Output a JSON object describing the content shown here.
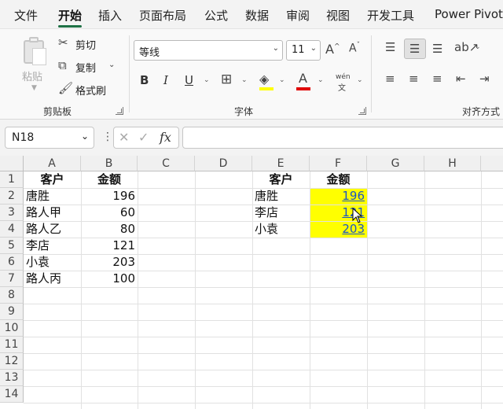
{
  "menu": {
    "tabs": [
      {
        "label": "文件"
      },
      {
        "label": "开始"
      },
      {
        "label": "插入"
      },
      {
        "label": "页面布局"
      },
      {
        "label": "公式"
      },
      {
        "label": "数据"
      },
      {
        "label": "审阅"
      },
      {
        "label": "视图"
      },
      {
        "label": "开发工具"
      },
      {
        "label": "Power Pivot"
      }
    ],
    "active": "开始"
  },
  "ribbon": {
    "clipboard": {
      "paste": "粘贴",
      "cut": "剪切",
      "copy": "复制",
      "format_painter": "格式刷",
      "group_label": "剪贴板"
    },
    "font": {
      "font_name": "等线",
      "font_size": "11",
      "bold": "B",
      "italic": "I",
      "underline": "U",
      "font_color_letter": "A",
      "phonetic": "wén",
      "group_label": "字体",
      "grow_icon": "A^",
      "shrink_icon": "Aˇ",
      "highlight_color": "#ffff00",
      "font_color": "#e00000"
    },
    "alignment": {
      "group_label": "对齐方式"
    }
  },
  "formula_bar": {
    "name_box": "N18",
    "fx": "fx",
    "formula": ""
  },
  "sheet": {
    "columns": [
      "A",
      "B",
      "C",
      "D",
      "E",
      "F",
      "G",
      "H"
    ],
    "rows": [
      "1",
      "2",
      "3",
      "4",
      "5",
      "6",
      "7",
      "8",
      "9",
      "10",
      "11",
      "12",
      "13",
      "14"
    ],
    "table1": {
      "header": {
        "customer": "客户",
        "amount": "金额"
      },
      "rows": [
        {
          "customer": "唐胜",
          "amount": "196"
        },
        {
          "customer": "路人甲",
          "amount": "60"
        },
        {
          "customer": "路人乙",
          "amount": "80"
        },
        {
          "customer": "李店",
          "amount": "121"
        },
        {
          "customer": "小袁",
          "amount": "203"
        },
        {
          "customer": "路人丙",
          "amount": "100"
        }
      ]
    },
    "table2": {
      "header": {
        "customer": "客户",
        "amount": "金额"
      },
      "rows": [
        {
          "customer": "唐胜",
          "amount": "196"
        },
        {
          "customer": "李店",
          "amount": "121"
        },
        {
          "customer": "小袁",
          "amount": "203"
        }
      ],
      "highlight_color": "#ffff00",
      "link_color": "#1a55c4"
    }
  }
}
